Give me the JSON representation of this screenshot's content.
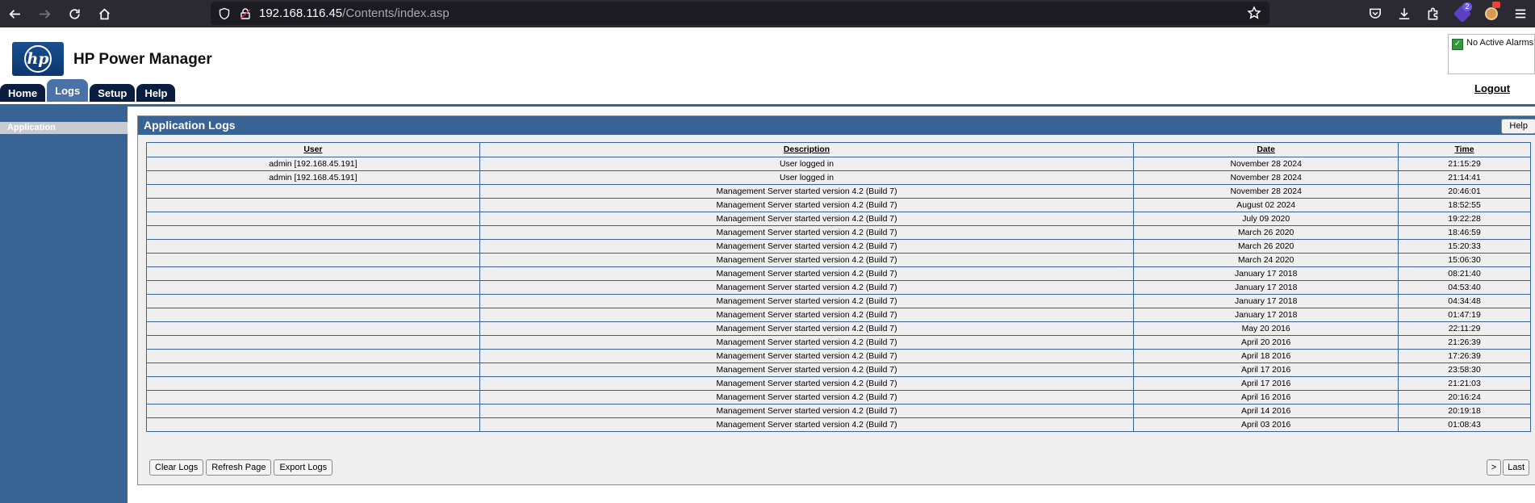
{
  "browser": {
    "url_host": "192.168.116.45",
    "url_path": "/Contents/index.asp",
    "extension_badge": "2"
  },
  "header": {
    "app_title": "HP Power Manager",
    "logo_text": "hp",
    "tabs": [
      {
        "label": "Home",
        "active": false
      },
      {
        "label": "Logs",
        "active": true
      },
      {
        "label": "Setup",
        "active": false
      },
      {
        "label": "Help",
        "active": false
      }
    ],
    "alarm_status": "No Active Alarms",
    "logout_label": "Logout"
  },
  "sidebar": {
    "items": [
      {
        "label": "Application",
        "selected": true
      }
    ]
  },
  "panel": {
    "title": "Application Logs",
    "help_label": "Help",
    "columns": [
      "User",
      "Description",
      "Date",
      "Time"
    ],
    "rows": [
      {
        "user": "admin [192.168.45.191]",
        "description": "User logged in",
        "date": "November 28 2024",
        "time": "21:15:29"
      },
      {
        "user": "admin [192.168.45.191]",
        "description": "User logged in",
        "date": "November 28 2024",
        "time": "21:14:41"
      },
      {
        "user": "",
        "description": "Management Server started version 4.2 (Build 7)",
        "date": "November 28 2024",
        "time": "20:46:01"
      },
      {
        "user": "",
        "description": "Management Server started version 4.2 (Build 7)",
        "date": "August 02 2024",
        "time": "18:52:55"
      },
      {
        "user": "",
        "description": "Management Server started version 4.2 (Build 7)",
        "date": "July 09 2020",
        "time": "19:22:28"
      },
      {
        "user": "",
        "description": "Management Server started version 4.2 (Build 7)",
        "date": "March 26 2020",
        "time": "18:46:59"
      },
      {
        "user": "",
        "description": "Management Server started version 4.2 (Build 7)",
        "date": "March 26 2020",
        "time": "15:20:33"
      },
      {
        "user": "",
        "description": "Management Server started version 4.2 (Build 7)",
        "date": "March 24 2020",
        "time": "15:06:30"
      },
      {
        "user": "",
        "description": "Management Server started version 4.2 (Build 7)",
        "date": "January 17 2018",
        "time": "08:21:40"
      },
      {
        "user": "",
        "description": "Management Server started version 4.2 (Build 7)",
        "date": "January 17 2018",
        "time": "04:53:40"
      },
      {
        "user": "",
        "description": "Management Server started version 4.2 (Build 7)",
        "date": "January 17 2018",
        "time": "04:34:48"
      },
      {
        "user": "",
        "description": "Management Server started version 4.2 (Build 7)",
        "date": "January 17 2018",
        "time": "01:47:19"
      },
      {
        "user": "",
        "description": "Management Server started version 4.2 (Build 7)",
        "date": "May 20 2016",
        "time": "22:11:29"
      },
      {
        "user": "",
        "description": "Management Server started version 4.2 (Build 7)",
        "date": "April 20 2016",
        "time": "21:26:39"
      },
      {
        "user": "",
        "description": "Management Server started version 4.2 (Build 7)",
        "date": "April 18 2016",
        "time": "17:26:39"
      },
      {
        "user": "",
        "description": "Management Server started version 4.2 (Build 7)",
        "date": "April 17 2016",
        "time": "23:58:30"
      },
      {
        "user": "",
        "description": "Management Server started version 4.2 (Build 7)",
        "date": "April 17 2016",
        "time": "21:21:03"
      },
      {
        "user": "",
        "description": "Management Server started version 4.2 (Build 7)",
        "date": "April 16 2016",
        "time": "20:16:24"
      },
      {
        "user": "",
        "description": "Management Server started version 4.2 (Build 7)",
        "date": "April 14 2016",
        "time": "20:19:18"
      },
      {
        "user": "",
        "description": "Management Server started version 4.2 (Build 7)",
        "date": "April 03 2016",
        "time": "01:08:43"
      }
    ],
    "buttons": {
      "clear_logs": "Clear Logs",
      "refresh_page": "Refresh Page",
      "export_logs": "Export Logs",
      "next": ">",
      "last": "Last"
    }
  },
  "colors": {
    "brand_blue": "#3a6395",
    "tab_dark": "#0b1d3f",
    "alarm_ok_green": "#2f9a3a"
  }
}
